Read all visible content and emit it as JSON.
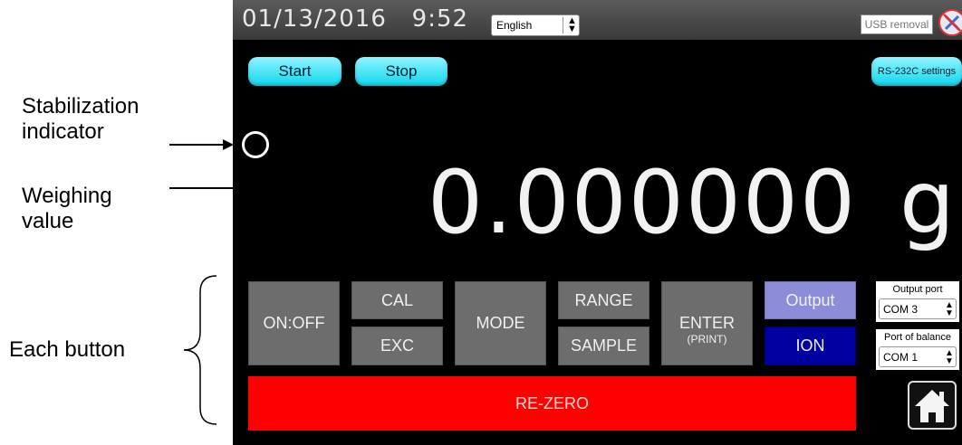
{
  "annotations": {
    "stabilization_line1": "Stabilization",
    "stabilization_line2": "indicator",
    "weighing_line1": "Weighing",
    "weighing_line2": "value",
    "each_button": "Each button"
  },
  "topbar": {
    "date": "01/13/2016",
    "time": "9:52",
    "language": "English",
    "usb_removal": "USB removal"
  },
  "controls": {
    "start": "Start",
    "stop": "Stop",
    "rs232c": "RS-232C settings"
  },
  "display": {
    "weight": "0.000000",
    "unit": "g"
  },
  "buttons": {
    "onoff": "ON:OFF",
    "cal": "CAL",
    "exc": "EXC",
    "mode": "MODE",
    "range": "RANGE",
    "sample": "SAMPLE",
    "enter": "ENTER",
    "enter_sub": "(PRINT)",
    "output": "Output",
    "ion": "ION",
    "rezero": "RE-ZERO"
  },
  "ports": {
    "output_port_label": "Output port",
    "output_port_value": "COM 3",
    "balance_port_label": "Port of balance",
    "balance_port_value": "COM 1"
  },
  "colors": {
    "accent_cyan": "#12d6ee",
    "output_button": "#8c8cd8",
    "ion_button": "#0000a0",
    "rezero_button": "#ff0000"
  },
  "icons": [
    "stabilization-indicator",
    "usb-removal-icon",
    "home-icon",
    "stepper-arrows-icon"
  ]
}
